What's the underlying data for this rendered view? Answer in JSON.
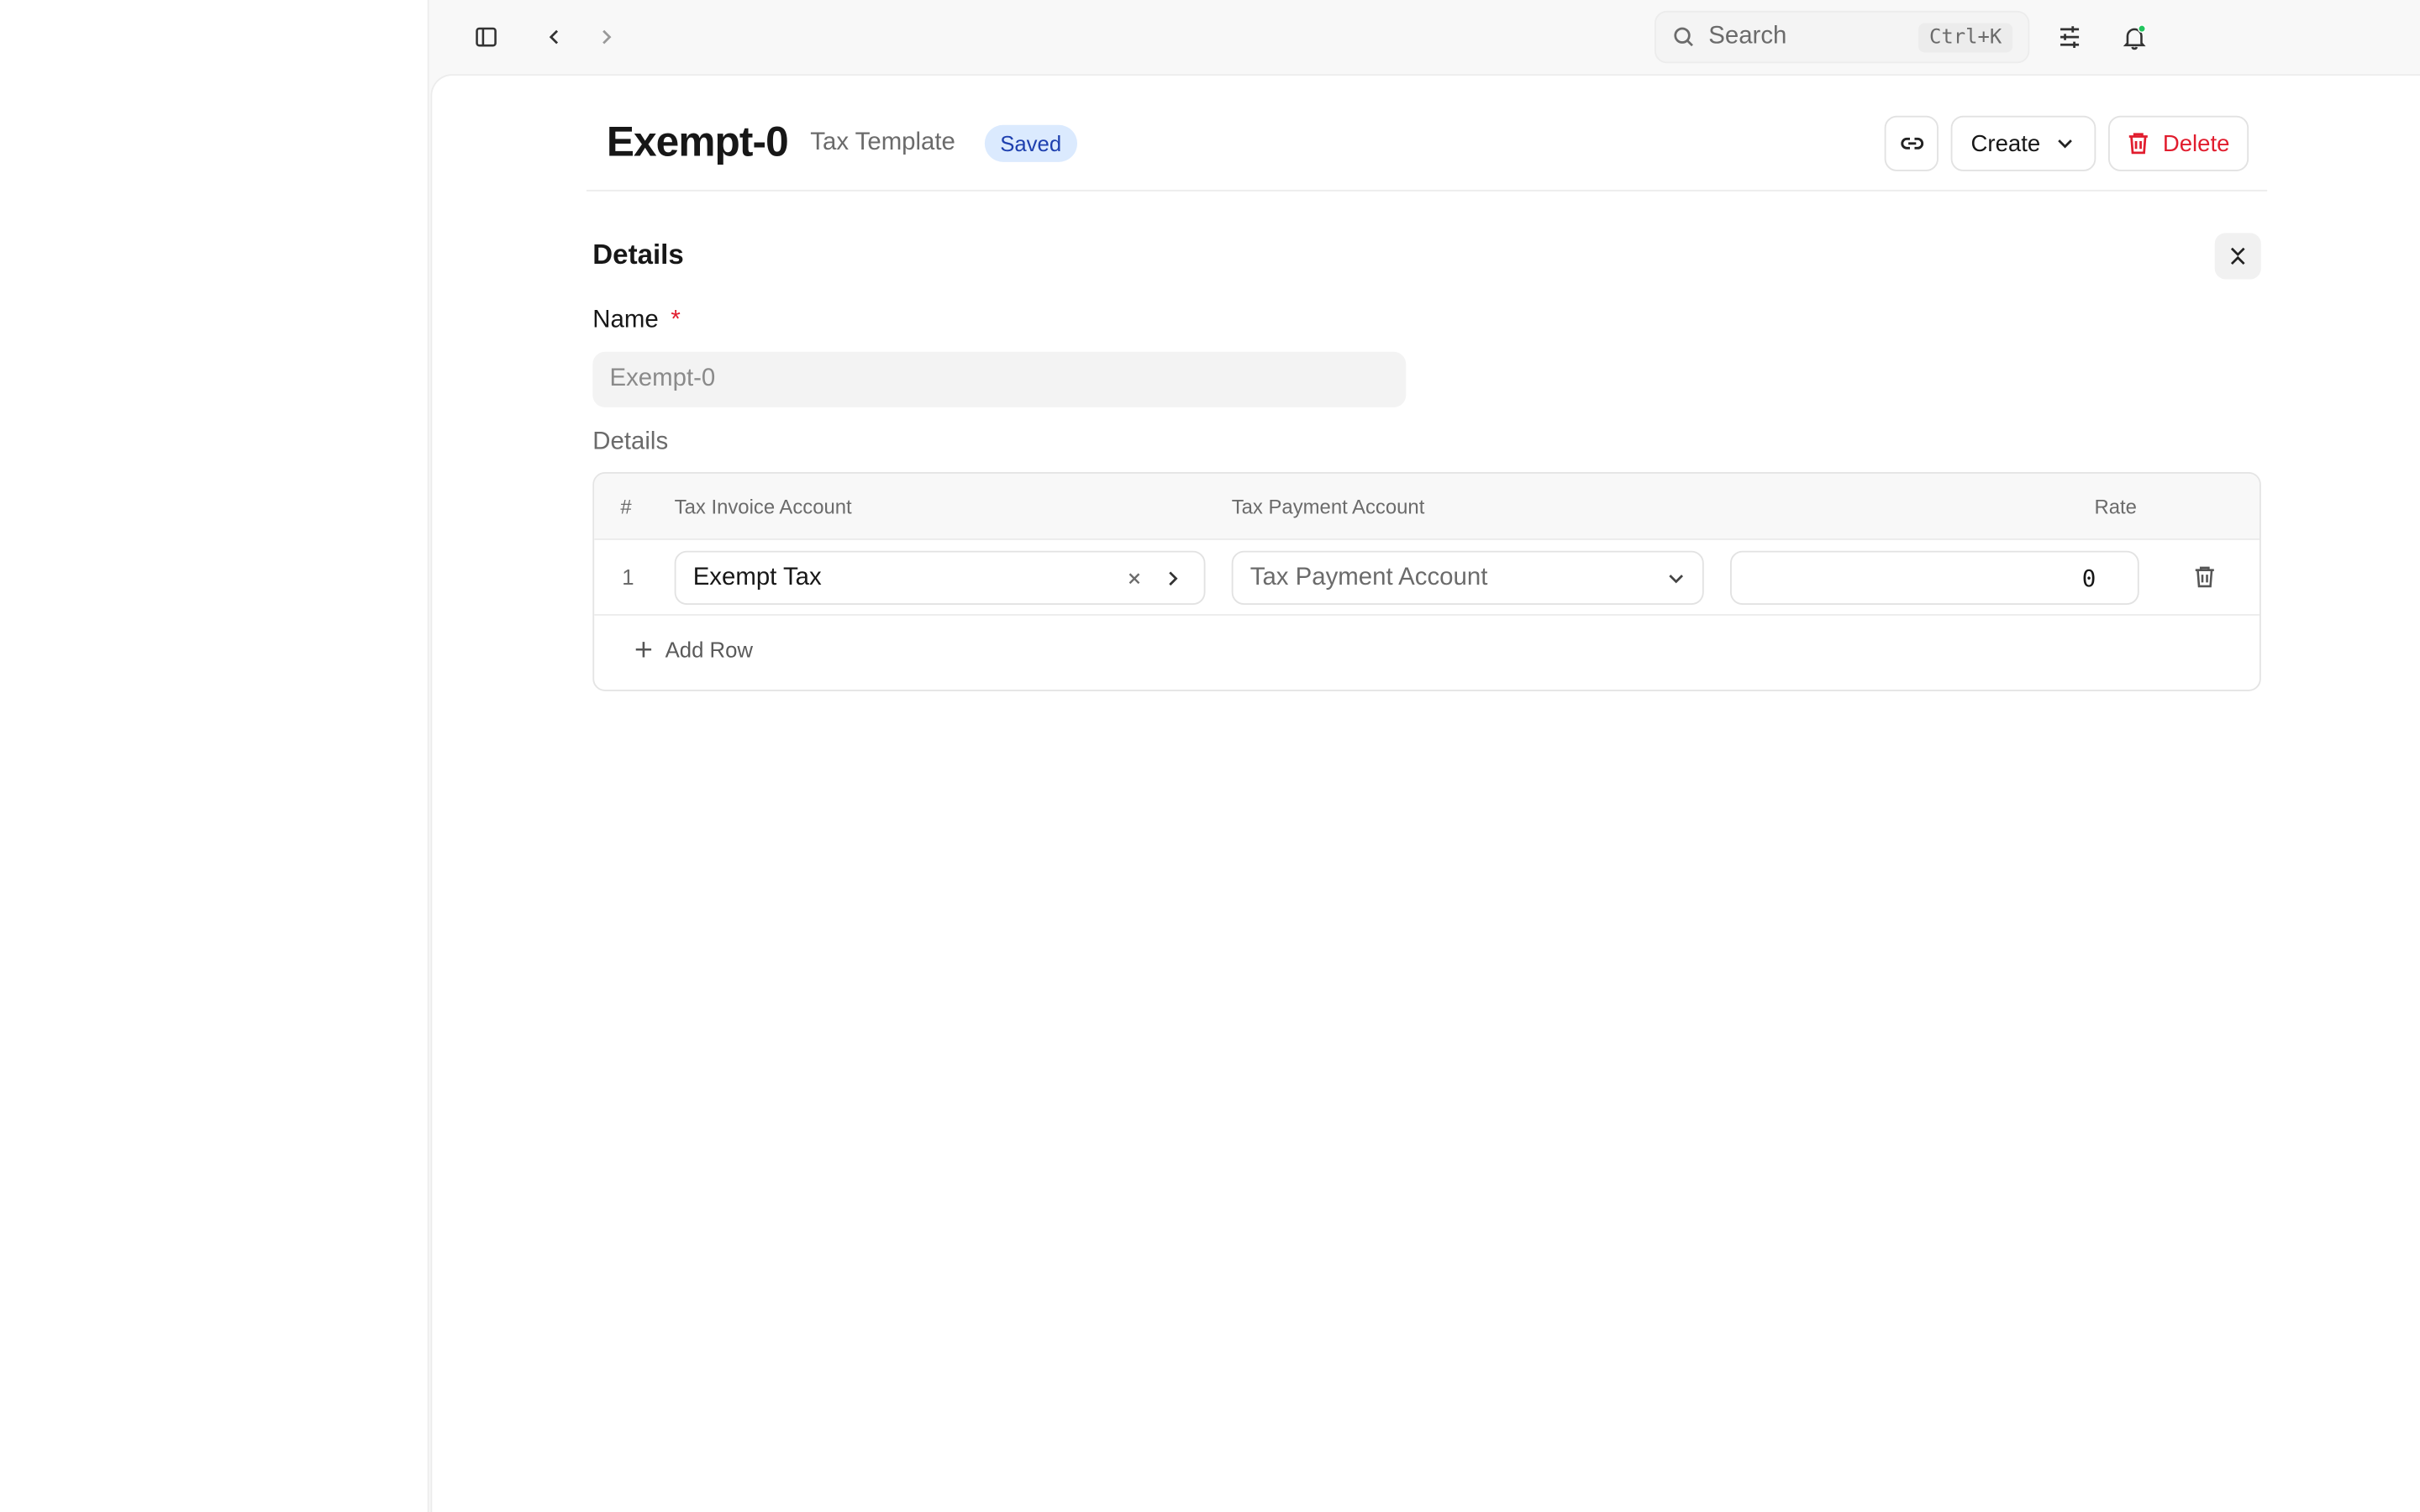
{
  "topbar": {
    "search_placeholder": "Search",
    "search_shortcut": "Ctrl+K",
    "notification_dot_color": "#22c55e"
  },
  "header": {
    "title": "Exempt-0",
    "subtitle": "Tax Template",
    "status_badge": "Saved",
    "create_label": "Create",
    "delete_label": "Delete"
  },
  "section": {
    "title": "Details",
    "name_label": "Name",
    "required_mark": "*",
    "name_value": "Exempt-0",
    "table_label": "Details"
  },
  "table": {
    "columns": [
      "#",
      "Tax Invoice Account",
      "Tax Payment Account",
      "Rate"
    ],
    "rows": [
      {
        "index": "1",
        "tax_invoice_account": "Exempt Tax",
        "tax_payment_account_placeholder": "Tax Payment Account",
        "rate": "0"
      }
    ],
    "add_row_label": "Add Row"
  },
  "colors": {
    "accent_badge_bg": "#dbeafe",
    "accent_badge_text": "#1e40af",
    "danger": "#e11d2e"
  }
}
